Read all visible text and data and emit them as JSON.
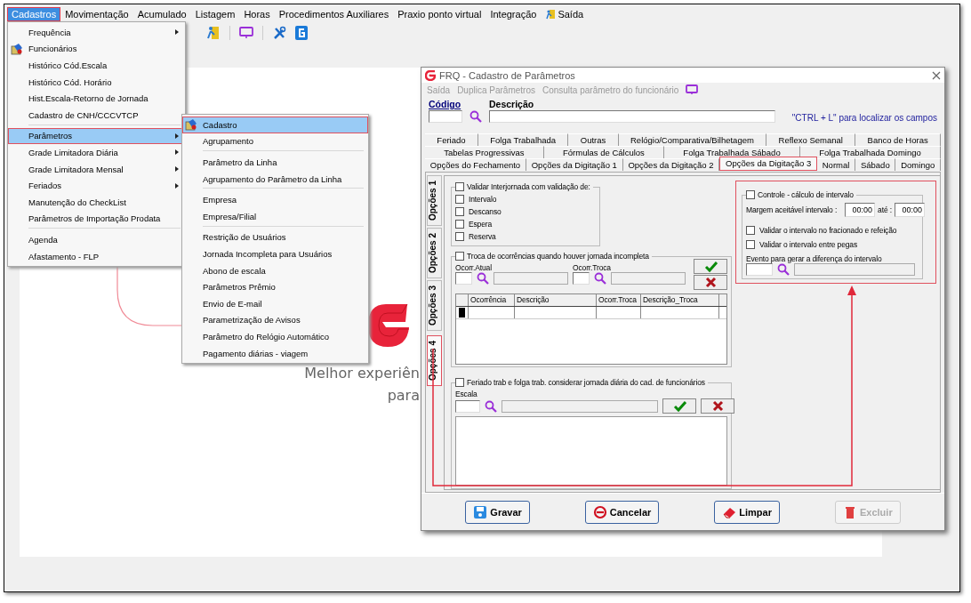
{
  "menubar": [
    {
      "label": "Cadastros",
      "kind": "text",
      "selected": true
    },
    {
      "label": "Movimentação",
      "kind": "text",
      "selected": false
    },
    {
      "label": "Acumulado",
      "kind": "text",
      "selected": false
    },
    {
      "label": "Listagem",
      "kind": "text",
      "selected": false
    },
    {
      "label": "Horas",
      "kind": "text",
      "selected": false
    },
    {
      "label": "Procedimentos Auxiliares",
      "kind": "text",
      "selected": false
    },
    {
      "label": "Praxio ponto virtual",
      "kind": "text",
      "selected": false
    },
    {
      "label": "Integração",
      "kind": "text",
      "selected": false
    },
    {
      "label": "Saída",
      "kind": "exit",
      "selected": false
    }
  ],
  "menu": [
    {
      "label": "Frequência",
      "kind": "plain",
      "submenu": true,
      "selected": false
    },
    {
      "label": "Funcionários",
      "kind": "icon",
      "submenu": false,
      "selected": false
    },
    {
      "label": "Histórico Cód.Escala",
      "kind": "plain",
      "submenu": false,
      "selected": false
    },
    {
      "label": "Histórico Cód. Horário",
      "kind": "plain",
      "submenu": false,
      "selected": false
    },
    {
      "label": "Hist.Escala-Retorno de Jornada",
      "kind": "plain",
      "submenu": false,
      "selected": false
    },
    {
      "label": "Cadastro de CNH/CCCVTCP",
      "kind": "plain",
      "submenu": false,
      "selected": false,
      "separator_after": true
    },
    {
      "label": "Parâmetros",
      "kind": "plain",
      "submenu": true,
      "selected": true
    },
    {
      "label": "Grade Limitadora Diária",
      "kind": "plain",
      "submenu": true,
      "selected": false
    },
    {
      "label": "Grade Limitadora Mensal",
      "kind": "plain",
      "submenu": true,
      "selected": false
    },
    {
      "label": "Feriados",
      "kind": "plain",
      "submenu": true,
      "selected": false
    },
    {
      "label": "Manutenção do CheckList",
      "kind": "plain",
      "submenu": false,
      "selected": false
    },
    {
      "label": "Parâmetros de Importação Prodata",
      "kind": "plain",
      "submenu": false,
      "selected": false,
      "separator_after": true
    },
    {
      "label": "Agenda",
      "kind": "plain",
      "submenu": false,
      "selected": false
    },
    {
      "label": "Afastamento - FLP",
      "kind": "plain",
      "submenu": false,
      "selected": false
    }
  ],
  "submenu": [
    {
      "label": "Cadastro",
      "kind": "icon",
      "selected": true
    },
    {
      "label": "Agrupamento",
      "kind": "plain",
      "selected": false,
      "separator_after": true
    },
    {
      "label": "Parâmetro da Linha",
      "kind": "plain",
      "selected": false
    },
    {
      "label": "Agrupamento do Parâmetro da Linha",
      "kind": "plain",
      "selected": false,
      "separator_after": true
    },
    {
      "label": "Empresa",
      "kind": "plain",
      "selected": false
    },
    {
      "label": "Empresa/Filial",
      "kind": "plain",
      "selected": false,
      "separator_after": true
    },
    {
      "label": "Restrição de Usuários",
      "kind": "plain",
      "selected": false
    },
    {
      "label": "Jornada Incompleta para Usuários",
      "kind": "plain",
      "selected": false
    },
    {
      "label": "Abono de escala",
      "kind": "plain",
      "selected": false
    },
    {
      "label": "Parâmetros Prêmio",
      "kind": "plain",
      "selected": false
    },
    {
      "label": "Envio de E-mail",
      "kind": "plain",
      "selected": false
    },
    {
      "label": "Parametrização de Avisos",
      "kind": "plain",
      "selected": false
    },
    {
      "label": "Parâmetro do Relógio Automático",
      "kind": "plain",
      "selected": false
    },
    {
      "label": "Pagamento diárias - viagem",
      "kind": "plain",
      "selected": false
    }
  ],
  "background": {
    "tagline": [
      "Melhor experiên",
      "para"
    ]
  },
  "dialog": {
    "title": "FRQ - Cadastro de Parâmetros",
    "menu": [
      {
        "label": "Saída",
        "disabled": true
      },
      {
        "label": "Duplica Parâmetros",
        "disabled": true
      },
      {
        "label": "Consulta parâmetro do funcionário",
        "disabled": true
      }
    ],
    "code_label": "Código",
    "description_label": "Descrição",
    "hint": "\"CTRL + L\" para localizar os campos",
    "tab_rows": [
      [
        {
          "label": "Feriado",
          "selected": false
        },
        {
          "label": "Folga Trabalhada",
          "selected": false
        },
        {
          "label": "Outras",
          "selected": false
        },
        {
          "label": "Relógio/Comparativa/Bilhetagem",
          "selected": false
        },
        {
          "label": "Reflexo Semanal",
          "selected": false
        },
        {
          "label": "Banco de Horas",
          "selected": false
        }
      ],
      [
        {
          "label": "Tabelas Progressivas",
          "selected": false
        },
        {
          "label": "Fórmulas de Cálculos",
          "selected": false
        },
        {
          "label": "Folga Trabalhada Sábado",
          "selected": false
        },
        {
          "label": "Folga Trabalhada Domingo",
          "selected": false
        }
      ],
      [
        {
          "label": "Opções do Fechamento",
          "selected": false
        },
        {
          "label": "Opções da Digitação 1",
          "selected": false
        },
        {
          "label": "Opções da Digitação 2",
          "selected": false
        },
        {
          "label": "Opções da Digitação 3",
          "selected": true
        },
        {
          "label": "Normal",
          "selected": false
        },
        {
          "label": "Sábado",
          "selected": false
        },
        {
          "label": "Domingo",
          "selected": false
        }
      ]
    ],
    "side_tabs": [
      {
        "label": "Opções 1",
        "selected": false
      },
      {
        "label": "Opções 2",
        "selected": false
      },
      {
        "label": "Opções 3",
        "selected": false
      },
      {
        "label": "Opções 4",
        "selected": true
      }
    ],
    "interjornada": {
      "label": "Validar Interjornada com validação de:",
      "checked": false,
      "options": [
        {
          "label": "Intervalo",
          "checked": false
        },
        {
          "label": "Descanso",
          "checked": false
        },
        {
          "label": "Espera",
          "checked": false
        },
        {
          "label": "Reserva",
          "checked": false
        }
      ]
    },
    "troca": {
      "label": "Troca de ocorrências quando houver jornada incompleta",
      "checked": false,
      "current_label": "Ocorr.Atual",
      "swap_label": "Ocorr.Troca",
      "columns": [
        "Ocorrência",
        "Descrição",
        "Ocorr.Troca",
        "Descrição_Troca"
      ]
    },
    "feriado": {
      "label": "Feriado trab e folga trab. considerar jornada diária do cad. de funcionários",
      "checked": false,
      "scale_label": "Escala"
    },
    "intervalo": {
      "label": "Controle - cálculo de intervalo",
      "checked": false,
      "annotated": true,
      "margin_label": "Margem aceitável intervalo :",
      "from": "00:00",
      "to_label": "até :",
      "to": "00:00",
      "options": [
        {
          "label": "Validar o intervalo no fracionado e refeição",
          "checked": false
        },
        {
          "label": "Validar o intervalo entre pegas",
          "checked": false
        }
      ],
      "event_label": "Evento para gerar a diferença do intervalo"
    },
    "buttons": [
      {
        "label": "Gravar",
        "kind": "save",
        "disabled": false
      },
      {
        "label": "Cancelar",
        "kind": "cancel",
        "disabled": false
      },
      {
        "label": "Limpar",
        "kind": "clear",
        "disabled": false
      },
      {
        "label": "Excluir",
        "kind": "delete",
        "disabled": true
      }
    ]
  }
}
